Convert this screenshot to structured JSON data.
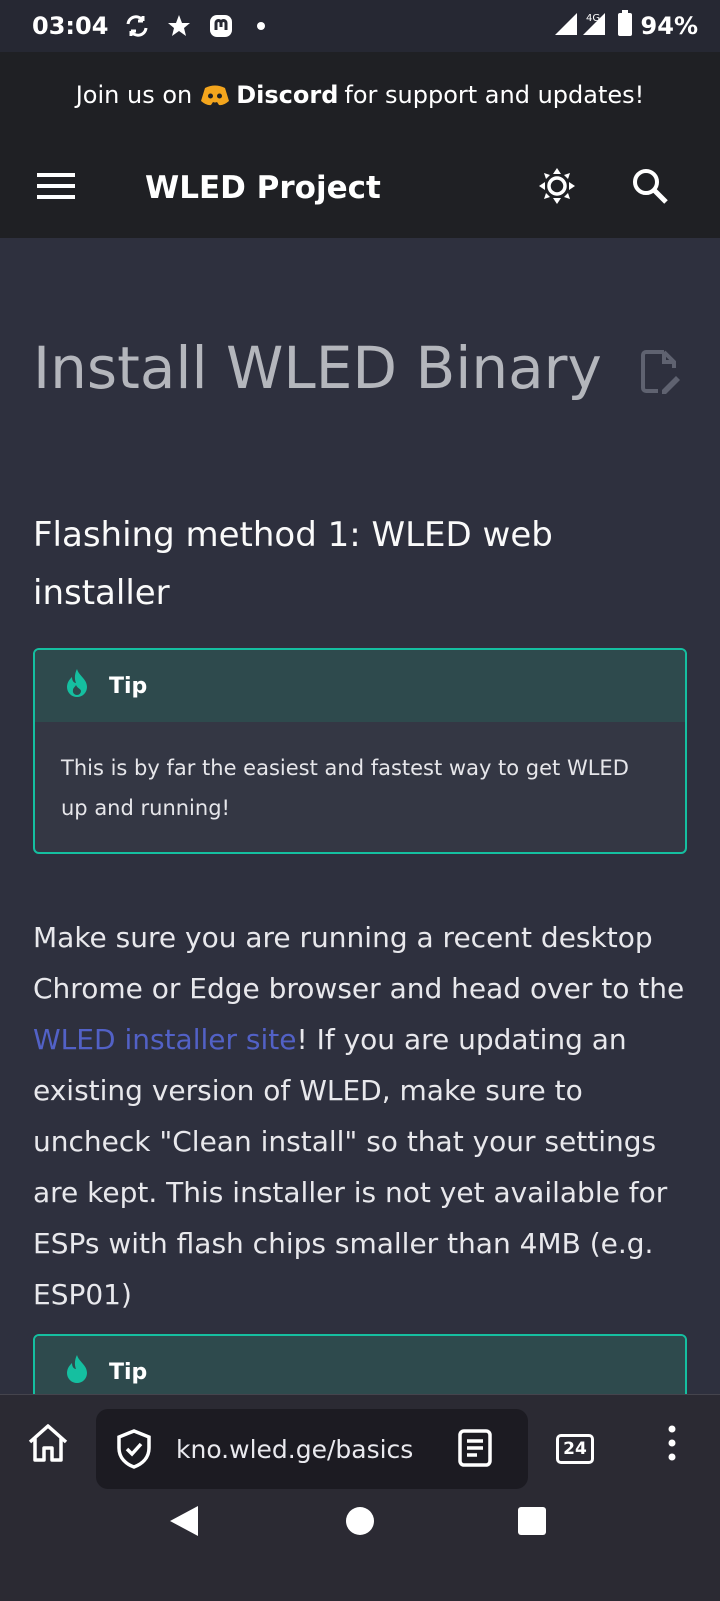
{
  "status": {
    "time": "03:04",
    "network": "4G",
    "battery": "94%",
    "icons": [
      "sync-icon",
      "star-icon",
      "mastodon-icon",
      "dot-icon",
      "signal-icon",
      "battery-icon"
    ]
  },
  "announcement": {
    "prefix": "Join us on",
    "link": "Discord",
    "suffix": "for support and updates!"
  },
  "header": {
    "title": "WLED Project",
    "icons": [
      "menu-icon",
      "theme-icon",
      "search-icon"
    ]
  },
  "page": {
    "title": "Install WLED Binary",
    "section_title": "Flashing method 1: WLED web installer",
    "tip1": {
      "label": "Tip",
      "body": "This is by far the easiest and fastest way to get WLED up and running!"
    },
    "paragraph": {
      "before_link": "Make sure you are running a recent desktop Chrome or Edge browser and head over to the",
      "link": "WLED installer site",
      "after_link": "! If you are updating an existing version of WLED, make sure to uncheck \"Clean install\" so that your settings are kept. This installer is not yet available for ESPs with flash chips smaller than 4MB (e.g. ESP01)"
    },
    "tip2": {
      "label": "Tip"
    }
  },
  "browser": {
    "url": "kno.wled.ge/basics",
    "tab_count": "24",
    "icons": [
      "home-icon",
      "shield-icon",
      "reader-icon",
      "tabs-icon",
      "more-icon"
    ]
  },
  "colors": {
    "background": "#2e303e",
    "header": "#1f2024",
    "accent": "#15bfa0",
    "link": "#5261c6"
  }
}
